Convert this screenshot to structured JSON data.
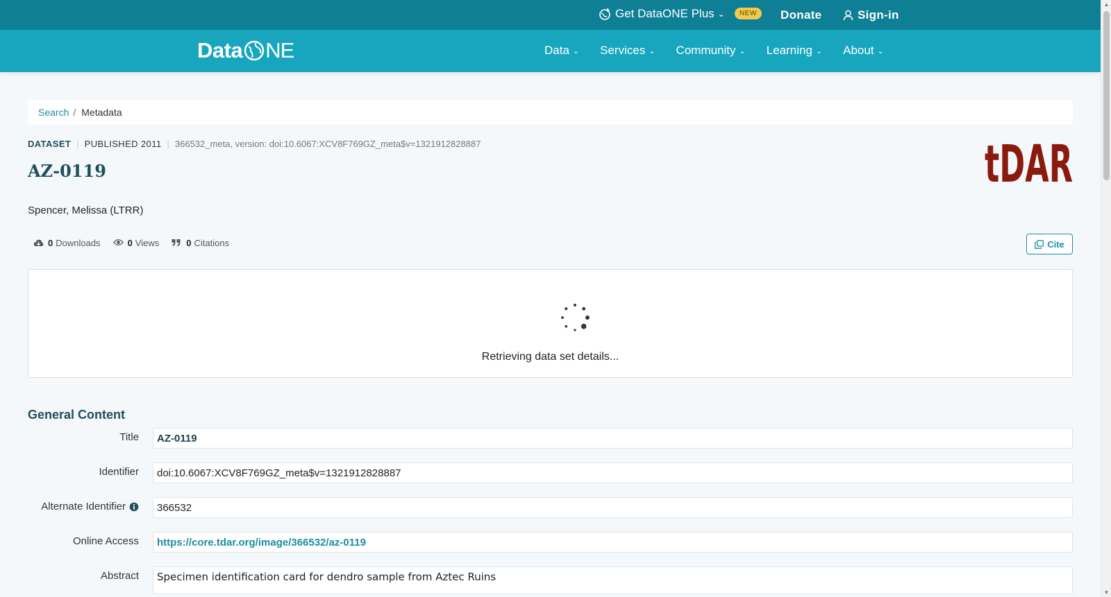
{
  "topbar": {
    "plus_label": "Get DataONE Plus",
    "badge": "NEW",
    "donate": "Donate",
    "signin": "Sign-in"
  },
  "nav": {
    "logo_data": "Data",
    "logo_one": "NE",
    "items": [
      "Data",
      "Services",
      "Community",
      "Learning",
      "About"
    ]
  },
  "breadcrumb": {
    "search": "Search",
    "sep": "/",
    "current": "Metadata"
  },
  "meta": {
    "type": "DATASET",
    "published": "PUBLISHED 2011",
    "version": "366532_meta, version: doi:10.6067:XCV8F769GZ_meta$v=1321912828887"
  },
  "dataset": {
    "title": "AZ-0119",
    "author": "Spencer, Melissa (LTRR)",
    "logo_text": "tDAR"
  },
  "stats": {
    "downloads_count": "0",
    "downloads_label": "Downloads",
    "views_count": "0",
    "views_label": "Views",
    "citations_count": "0",
    "citations_label": "Citations"
  },
  "cite_label": "Cite",
  "loading_message": "Retrieving data set details...",
  "general": {
    "section_title": "General Content",
    "fields": [
      {
        "label": "Title",
        "value": "AZ-0119"
      },
      {
        "label": "Identifier",
        "value": "doi:10.6067:XCV8F769GZ_meta$v=1321912828887"
      },
      {
        "label": "Alternate Identifier",
        "value": "366532"
      },
      {
        "label": "Online Access",
        "value": "https://core.tdar.org/image/366532/az-0119"
      },
      {
        "label": "Abstract",
        "value": "Specimen identification card for dendro sample from Aztec Ruins"
      }
    ]
  },
  "colors": {
    "topbar": "#0f7f95",
    "nav": "#17a6bd",
    "accent": "#1b8ea3",
    "heading": "#1f4e5c",
    "tdar": "#8b1a0e",
    "badge": "#f2c94c"
  }
}
